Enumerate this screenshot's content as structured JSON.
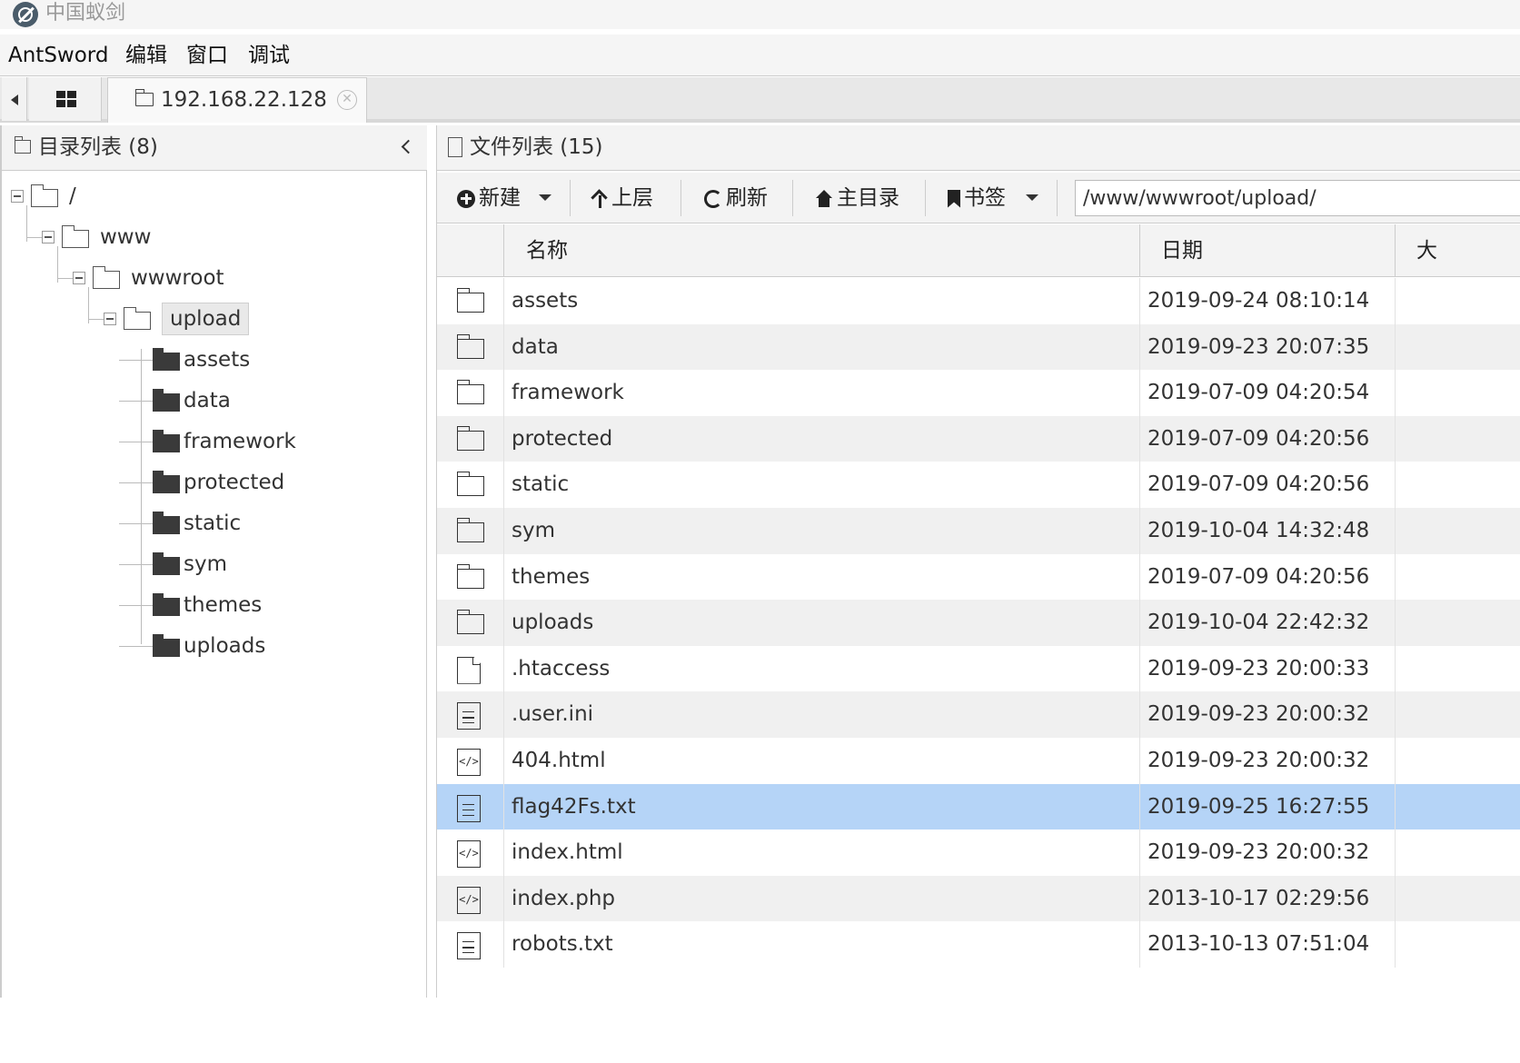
{
  "app": {
    "title": "中国蚁剑"
  },
  "menu": [
    "AntSword",
    "编辑",
    "窗口",
    "调试"
  ],
  "tab": {
    "label": "192.168.22.128"
  },
  "left_panel": {
    "title": "目录列表 (8)",
    "tree": [
      {
        "label": "/",
        "depth": 0,
        "expanded": true
      },
      {
        "label": "www",
        "depth": 1,
        "expanded": true
      },
      {
        "label": "wwwroot",
        "depth": 2,
        "expanded": true
      },
      {
        "label": "upload",
        "depth": 3,
        "expanded": true,
        "selected": true
      },
      {
        "label": "assets",
        "depth": 4
      },
      {
        "label": "data",
        "depth": 4
      },
      {
        "label": "framework",
        "depth": 4
      },
      {
        "label": "protected",
        "depth": 4
      },
      {
        "label": "static",
        "depth": 4
      },
      {
        "label": "sym",
        "depth": 4
      },
      {
        "label": "themes",
        "depth": 4
      },
      {
        "label": "uploads",
        "depth": 4
      }
    ]
  },
  "right_panel": {
    "title": "文件列表 (15)",
    "toolbar": {
      "new_label": "新建",
      "up_label": "上层",
      "refresh_label": "刷新",
      "home_label": "主目录",
      "bookmark_label": "书签"
    },
    "path": "/www/wwwroot/upload/",
    "columns": {
      "name": "名称",
      "date": "日期",
      "size": "大"
    },
    "files": [
      {
        "name": "assets",
        "date": "2019-09-24 08:10:14",
        "icon": "folder-icon"
      },
      {
        "name": "data",
        "date": "2019-09-23 20:07:35",
        "icon": "folder-icon"
      },
      {
        "name": "framework",
        "date": "2019-07-09 04:20:54",
        "icon": "folder-icon"
      },
      {
        "name": "protected",
        "date": "2019-07-09 04:20:56",
        "icon": "folder-icon"
      },
      {
        "name": "static",
        "date": "2019-07-09 04:20:56",
        "icon": "folder-icon"
      },
      {
        "name": "sym",
        "date": "2019-10-04 14:32:48",
        "icon": "folder-icon"
      },
      {
        "name": "themes",
        "date": "2019-07-09 04:20:56",
        "icon": "folder-icon"
      },
      {
        "name": "uploads",
        "date": "2019-10-04 22:42:32",
        "icon": "folder-icon"
      },
      {
        "name": ".htaccess",
        "date": "2019-09-23 20:00:33",
        "icon": "file-icon"
      },
      {
        "name": ".user.ini",
        "date": "2019-09-23 20:00:32",
        "icon": "text-file-icon"
      },
      {
        "name": "404.html",
        "date": "2019-09-23 20:00:32",
        "icon": "code-file-icon"
      },
      {
        "name": "flag42Fs.txt",
        "date": "2019-09-25 16:27:55",
        "icon": "text-file-icon",
        "selected": true
      },
      {
        "name": "index.html",
        "date": "2019-09-23 20:00:32",
        "icon": "code-file-icon"
      },
      {
        "name": "index.php",
        "date": "2013-10-17 02:29:56",
        "icon": "code-file-icon"
      },
      {
        "name": "robots.txt",
        "date": "2013-10-13 07:51:04",
        "icon": "text-file-icon"
      }
    ]
  }
}
